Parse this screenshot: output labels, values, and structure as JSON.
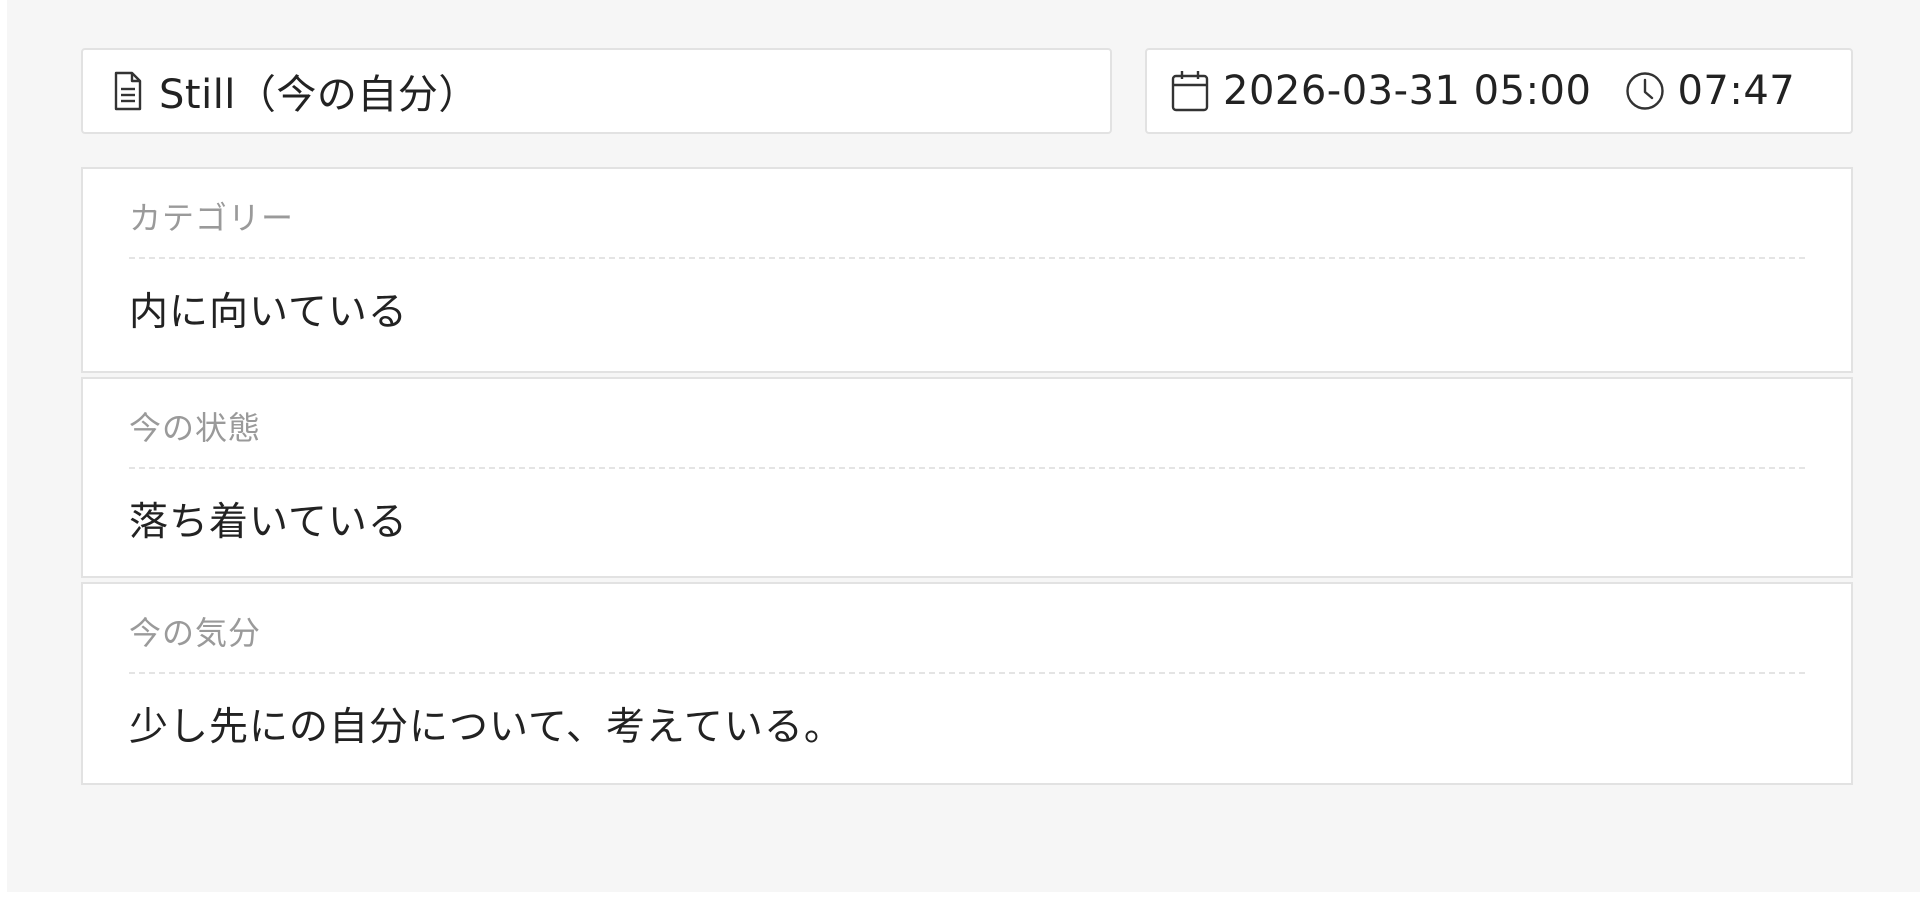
{
  "header": {
    "title": "Still（今の自分）",
    "title_icon": "document-icon",
    "date": "2026-03-31 05:00",
    "date_icon": "calendar-icon",
    "time": "07:47",
    "time_icon": "clock-icon"
  },
  "sections": [
    {
      "label": "カテゴリー",
      "value": "内に向いている"
    },
    {
      "label": "今の状態",
      "value": "落ち着いている"
    },
    {
      "label": "今の気分",
      "value": "少し先にの自分について、考えている。"
    }
  ],
  "colors": {
    "background": "#f6f6f6",
    "card": "#ffffff",
    "border": "#e2e2e2",
    "label_text": "#9a9a9a",
    "value_text": "#222222"
  }
}
